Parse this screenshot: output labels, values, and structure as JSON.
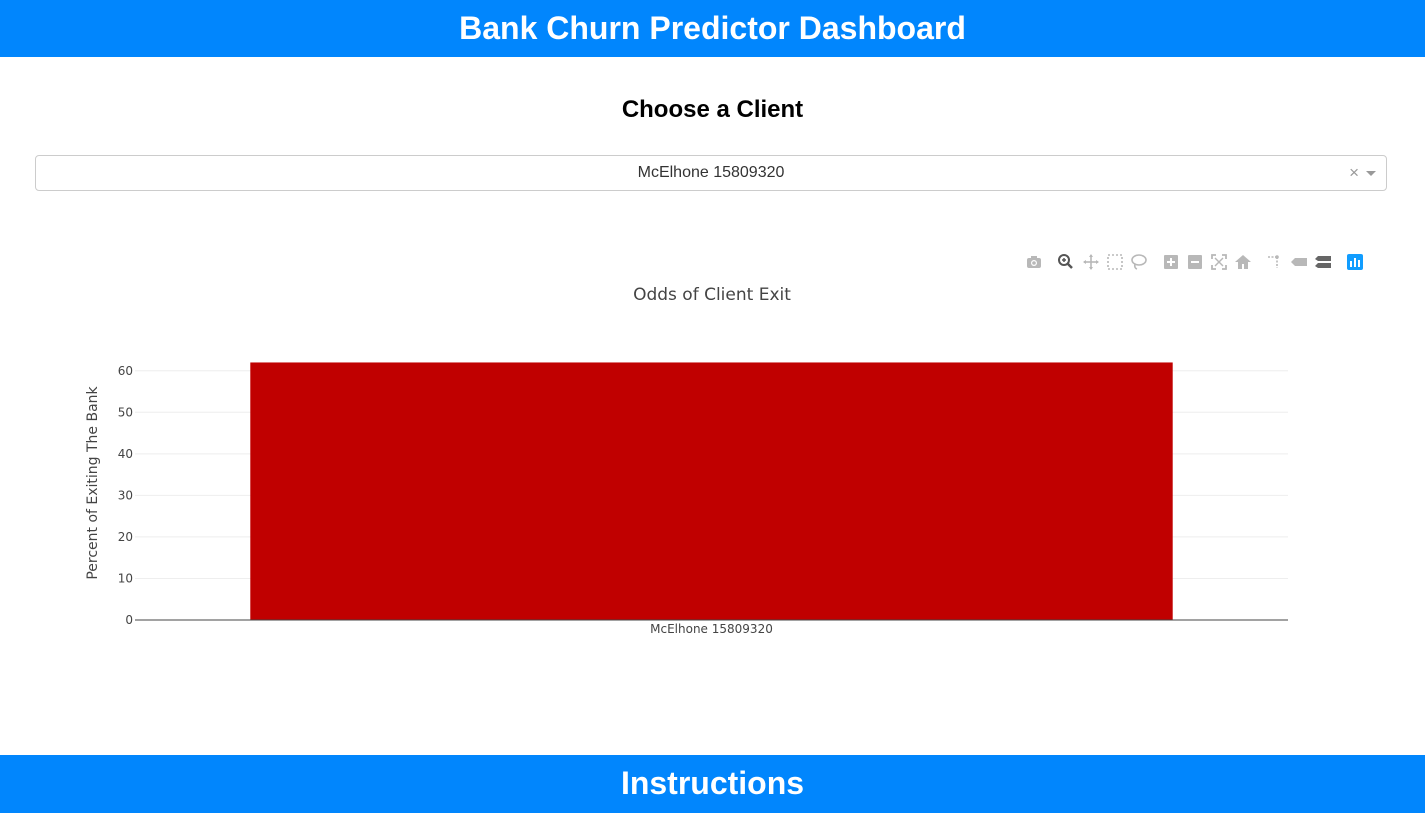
{
  "header": {
    "title": "Bank Churn Predictor Dashboard"
  },
  "client_section": {
    "title": "Choose a Client"
  },
  "client_dropdown": {
    "selected": "McElhone 15809320",
    "clear_symbol": "×"
  },
  "modebar": {
    "icons": [
      "camera-icon",
      "zoom-icon",
      "pan-icon",
      "box-select-icon",
      "lasso-select-icon",
      "zoom-in-icon",
      "zoom-out-icon",
      "autoscale-icon",
      "reset-axes-icon",
      "spike-lines-icon",
      "hover-closest-icon",
      "hover-compare-icon",
      "plotly-logo-icon"
    ]
  },
  "chart_data": {
    "type": "bar",
    "title": "Odds of Client Exit",
    "xlabel": "",
    "ylabel": "Percent of Exiting The Bank",
    "categories": [
      "McElhone 15809320"
    ],
    "values": [
      62
    ],
    "ylim": [
      0,
      65
    ],
    "yticks": [
      0,
      10,
      20,
      30,
      40,
      50,
      60
    ],
    "grid": true,
    "bar_color": "#c00000"
  },
  "footer": {
    "title": "Instructions"
  }
}
